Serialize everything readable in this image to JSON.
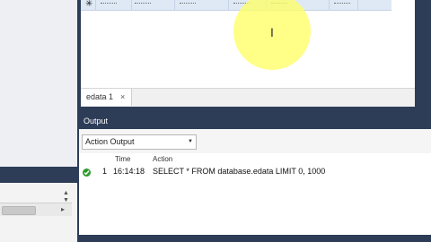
{
  "editor": {
    "tab_label": "edata 1",
    "tab_close": "×",
    "new_row_marker": "✳"
  },
  "output": {
    "header": "Output",
    "selected_view": "Action Output",
    "columns": [
      "Time",
      "Action"
    ],
    "rows": [
      {
        "status": "success",
        "number": "1",
        "time": "16:14:18",
        "action": "SELECT * FROM database.edata LIMIT 0, 1000"
      }
    ]
  },
  "colors": {
    "frame": "#2d3d58",
    "success": "#2e9a2e",
    "cursor_highlight": "#ffff66"
  },
  "icons": [
    "ibeam-cursor-icon",
    "checkmark-icon",
    "chevron-down-icon",
    "close-icon"
  ]
}
